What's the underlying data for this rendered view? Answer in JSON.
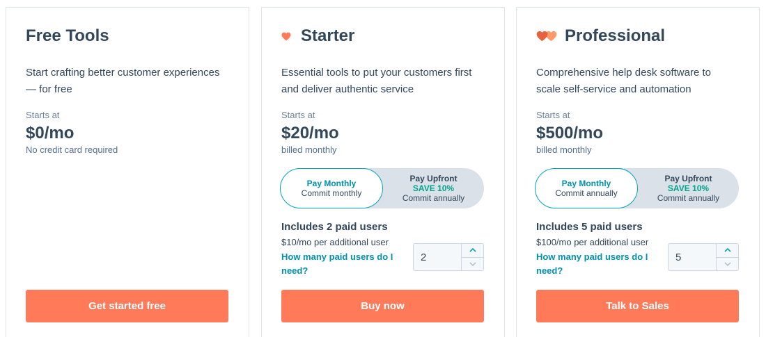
{
  "plans": [
    {
      "name": "Free Tools",
      "description": "Start crafting better customer experiences — for free",
      "starts_at_label": "Starts at",
      "price": "$0/mo",
      "price_note": "No credit card required",
      "cta_label": "Get started free"
    },
    {
      "name": "Starter",
      "icon": "heart-icon",
      "description": "Essential tools to put your customers first and deliver authentic service",
      "starts_at_label": "Starts at",
      "price": "$20/mo",
      "price_note": "billed monthly",
      "billing_toggle": {
        "monthly": {
          "label": "Pay Monthly",
          "commitment": "Commit monthly",
          "selected": true
        },
        "upfront": {
          "label": "Pay Upfront",
          "discount": "SAVE 10%",
          "commitment": "Commit annually",
          "selected": false
        }
      },
      "users": {
        "included": "Includes 2 paid users",
        "additional_price": "$10/mo per additional user",
        "help_link": "How many paid users do I need?",
        "quantity": 2
      },
      "cta_label": "Buy now"
    },
    {
      "name": "Professional",
      "icon": "double-heart-icon",
      "description": "Comprehensive help desk software to scale self-service and automation",
      "starts_at_label": "Starts at",
      "price": "$500/mo",
      "price_note": "billed monthly",
      "billing_toggle": {
        "monthly": {
          "label": "Pay Monthly",
          "commitment": "Commit annually",
          "selected": true
        },
        "upfront": {
          "label": "Pay Upfront",
          "discount": "SAVE 10%",
          "commitment": "Commit annually",
          "selected": false
        }
      },
      "users": {
        "included": "Includes 5 paid users",
        "additional_price": "$100/mo per additional user",
        "help_link": "How many paid users do I need?",
        "quantity": 5
      },
      "cta_label": "Talk to Sales"
    }
  ],
  "stepper_icons": {
    "increment": "chevron-up-icon",
    "decrement": "chevron-down-icon"
  },
  "colors": {
    "text": "#33475b",
    "accent": "#ff7a59",
    "toggle_border": "#00a4bd",
    "link": "#0091ae",
    "save": "#00a38d",
    "toggle_bg": "#dbe1e9"
  }
}
